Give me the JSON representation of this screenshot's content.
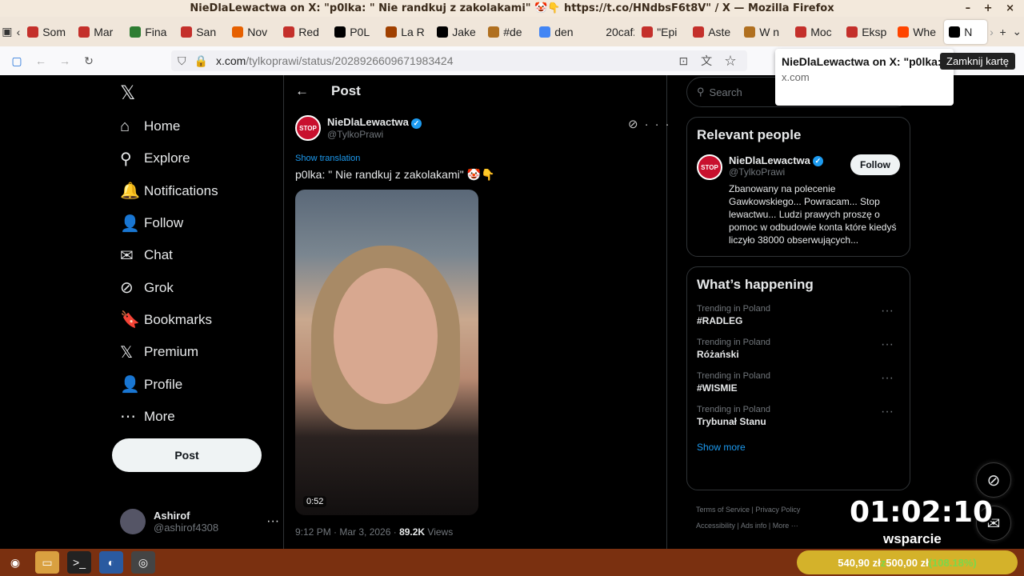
{
  "window": {
    "title": "NieDlaLewactwa on X: \"p0lka: \" Nie randkuj z zakolakami\" 🤡👇 https://t.co/HNdbsF6t8V\" / X — Mozilla Firefox",
    "controls": "– + ×"
  },
  "tabs": [
    {
      "label": "Som",
      "color": "#c4302b"
    },
    {
      "label": "Mar",
      "color": "#c4302b"
    },
    {
      "label": "Fina",
      "color": "#2e7d32"
    },
    {
      "label": "San",
      "color": "#c4302b"
    },
    {
      "label": "Nov",
      "color": "#e66000"
    },
    {
      "label": "Red",
      "color": "#c4302b"
    },
    {
      "label": "P0L",
      "color": "#000000"
    },
    {
      "label": "La R",
      "color": "#a04000"
    },
    {
      "label": "Jake",
      "color": "#000000"
    },
    {
      "label": "#de",
      "color": "#b07020"
    },
    {
      "label": "den",
      "color": "#4285f4"
    },
    {
      "label": "20caf2",
      "color": "#f0e6da"
    },
    {
      "label": "\"Epi",
      "color": "#c4302b"
    },
    {
      "label": "Aste",
      "color": "#c4302b"
    },
    {
      "label": "W n",
      "color": "#b07020"
    },
    {
      "label": "Moc",
      "color": "#c4302b"
    },
    {
      "label": "Eksp",
      "color": "#c4302b"
    },
    {
      "label": "Whe",
      "color": "#ff4500"
    },
    {
      "label": "N",
      "color": "#000000"
    }
  ],
  "url": {
    "domain": "x.com",
    "path": "/tylkoprawi/status/2028926609671983424"
  },
  "tab_tooltip": {
    "title": "NieDlaLewactwa on X: \"p0lka: \" Nie randkuj z zakolakami\"...",
    "domain": "x.com"
  },
  "close_tab_tooltip": "Zamknij kartę",
  "nav": [
    {
      "label": "Home",
      "icon": "⌂"
    },
    {
      "label": "Explore",
      "icon": "⚲"
    },
    {
      "label": "Notifications",
      "icon": "🔔"
    },
    {
      "label": "Follow",
      "icon": "👤"
    },
    {
      "label": "Chat",
      "icon": "✉"
    },
    {
      "label": "Grok",
      "icon": "⊘"
    },
    {
      "label": "Bookmarks",
      "icon": "🔖"
    },
    {
      "label": "Premium",
      "icon": "𝕏"
    },
    {
      "label": "Profile",
      "icon": "👤"
    },
    {
      "label": "More",
      "icon": "⋯"
    }
  ],
  "post_button": "Post",
  "account": {
    "name": "Ashirof",
    "handle": "@ashirof4308"
  },
  "post_header": "Post",
  "tweet": {
    "author": "NieDlaLewactwa",
    "handle": "@TylkoPrawi",
    "show_translation": "Show translation",
    "text": "p0lka: \" Nie randkuj z zakolakami\" 🤡👇",
    "duration": "0:52",
    "timestamp": "9:12 PM · Mar 3, 2026 · ",
    "views_count": "89.2K",
    "views_label": " Views"
  },
  "search_placeholder": "Search",
  "relevant": {
    "heading": "Relevant people",
    "name": "NieDlaLewactwa",
    "handle": "@TylkoPrawi",
    "follow": "Follow",
    "bio": "Zbanowany na polecenie Gawkowskiego... Powracam... Stop lewactwu... Ludzi prawych proszę o pomoc w odbudowie konta które kiedyś liczyło 38000 obserwujących..."
  },
  "happening": {
    "heading": "What’s happening",
    "trends": [
      {
        "label": "Trending in Poland",
        "name": "#RADLEG"
      },
      {
        "label": "Trending in Poland",
        "name": "Różański"
      },
      {
        "label": "Trending in Poland",
        "name": "#WISMIE"
      },
      {
        "label": "Trending in Poland",
        "name": "Trybunał Stanu"
      }
    ],
    "show_more": "Show more"
  },
  "footer": [
    "Terms of Service",
    "Privacy Policy",
    "Accessibility",
    "Ads info",
    "More ···"
  ],
  "overlay": {
    "timer": "01:02:10",
    "label": "wsparcie"
  },
  "donation": {
    "current": "540,90 zł",
    "sep": " z ",
    "goal": "500,00 zł",
    "pct": " (108.18%)"
  }
}
